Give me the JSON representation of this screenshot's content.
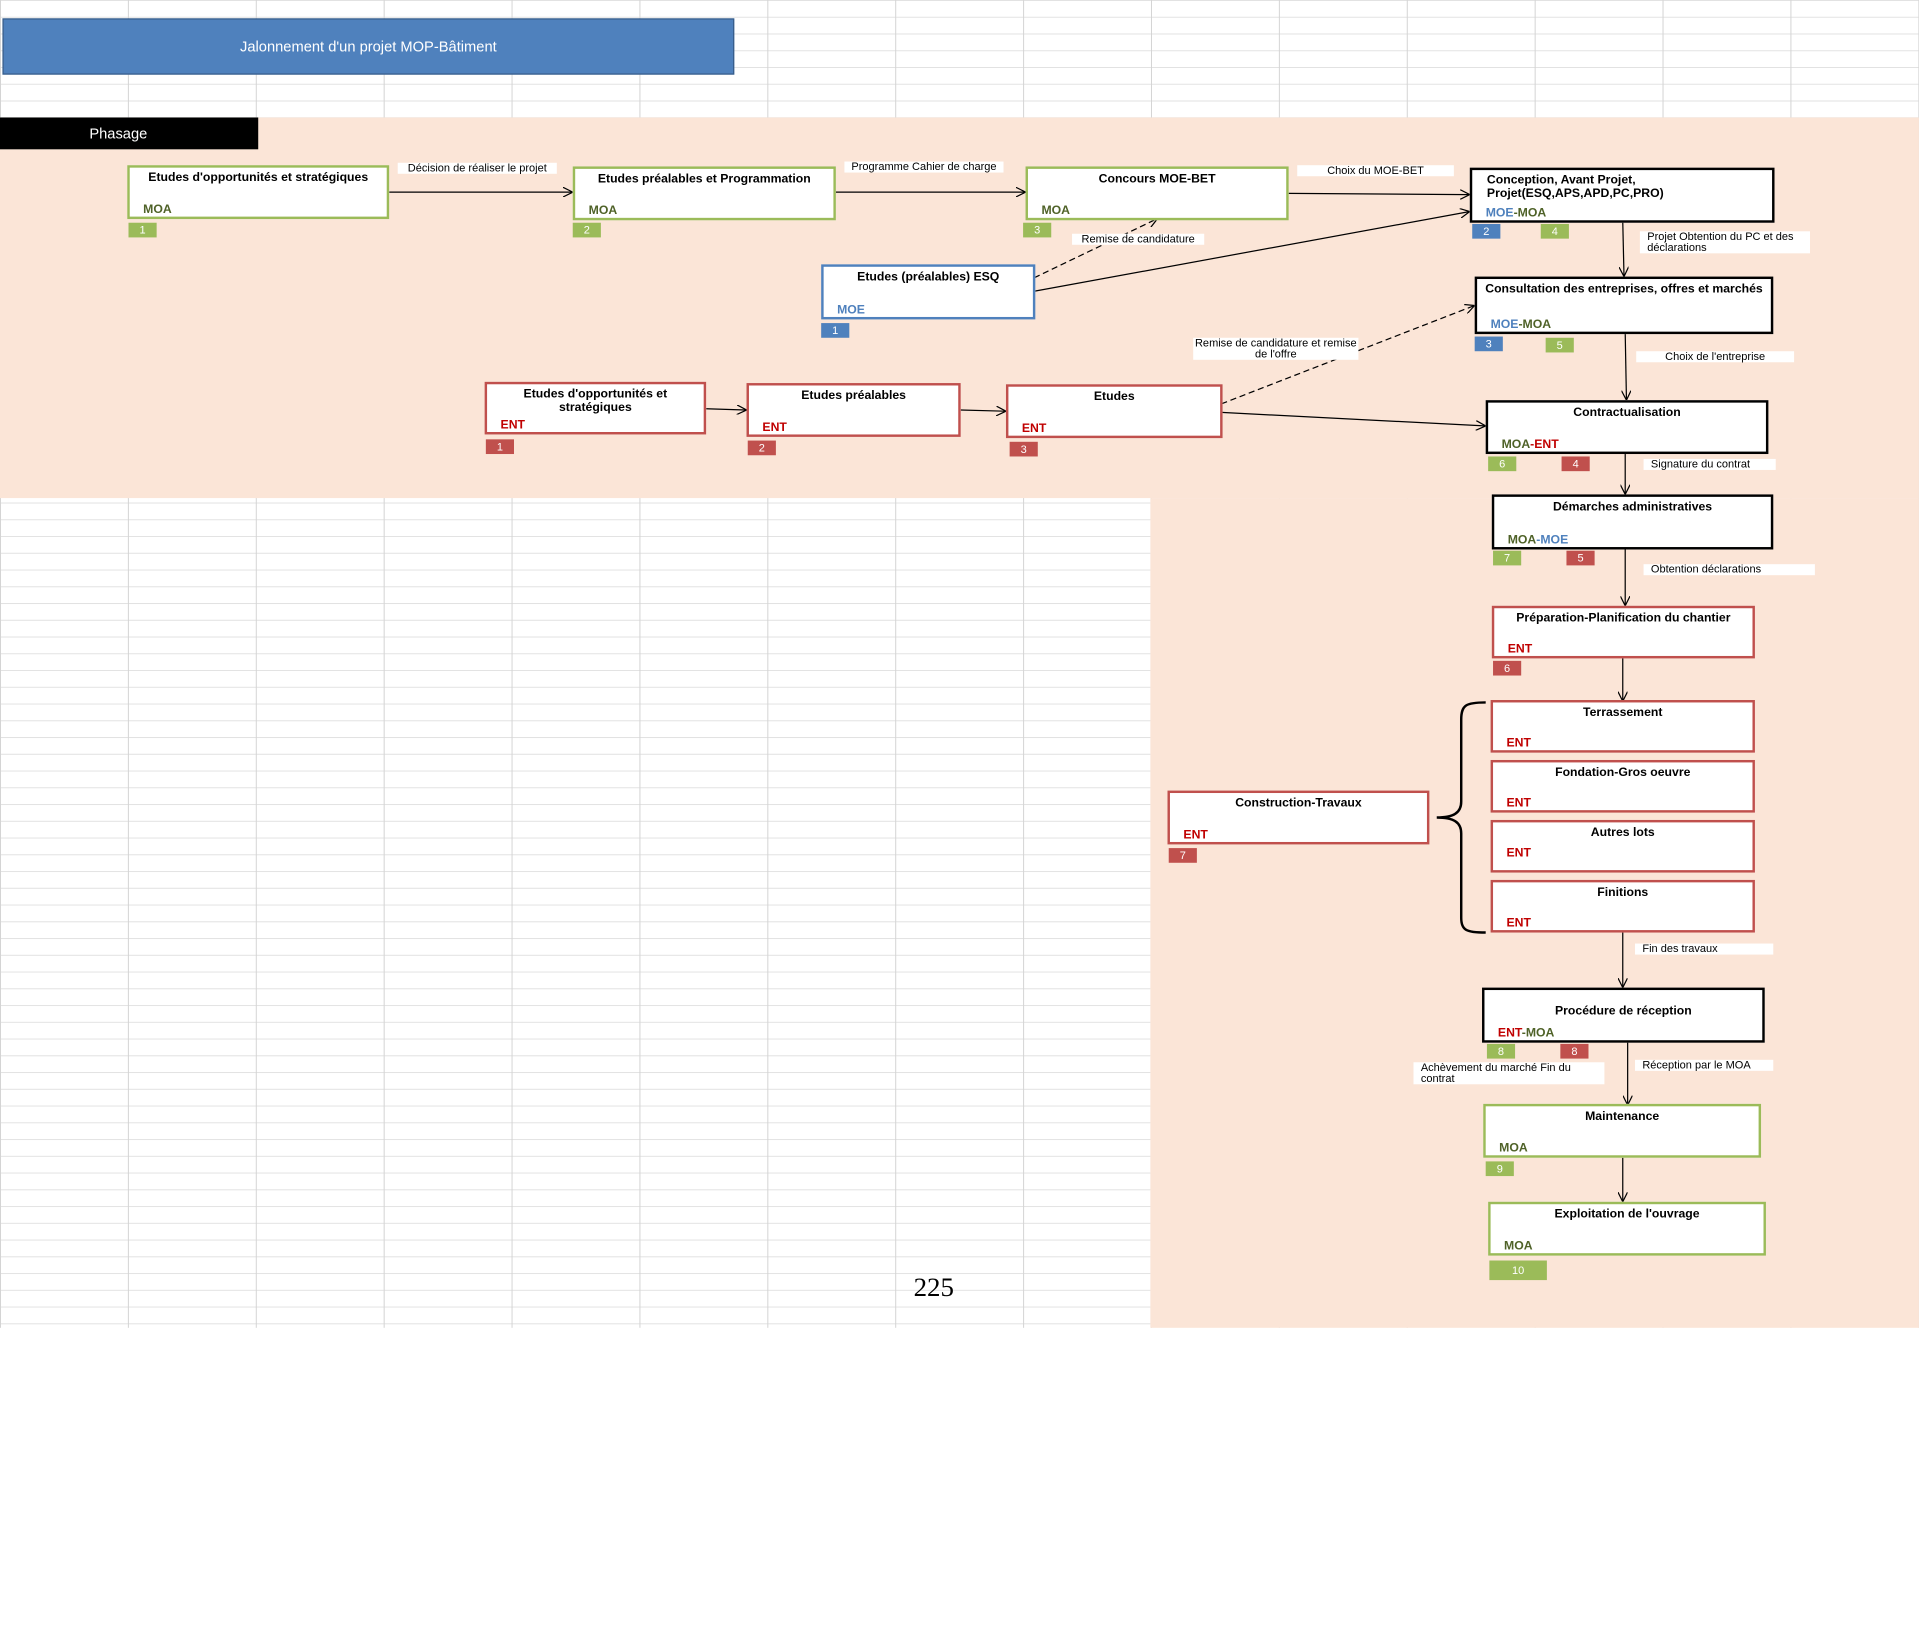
{
  "title": "Jalonnement d'un projet MOP-Bâtiment",
  "phase_label": "Phasage",
  "page_number": "225",
  "colors": {
    "moa": "#9bbb59",
    "moe": "#4f81bd",
    "ent": "#c0504d",
    "fill": "#fbe5d7"
  },
  "boxes": {
    "moa_etudes_opp": {
      "title": "Etudes d'opportunités  et stratégiques",
      "role": "MOA",
      "num": "1"
    },
    "moa_etudes_prea": {
      "title": "Etudes  préalables et Programmation",
      "role": "MOA",
      "num": "2"
    },
    "moa_concours": {
      "title": "Concours  MOE-BET",
      "role": "MOA",
      "num": "3"
    },
    "moe_esq": {
      "title": "Etudes  (préalables) ESQ",
      "role": "MOE",
      "num": "1"
    },
    "conception": {
      "title": "Conception,  Avant Projet, Projet(ESQ,APS,APD,PC,PRO)",
      "role_a": "MOE",
      "role_b": "-MOA",
      "num_a": "2",
      "num_b": "4"
    },
    "consultation": {
      "title": "Consultation  des entreprises, offres et marchés",
      "role_a": "MOE",
      "role_b": "-MOA",
      "num_a": "3",
      "num_b": "5"
    },
    "ent_etudes_opp": {
      "title": "Etudes d'opportunités et stratégiques",
      "role": "ENT",
      "num": "1"
    },
    "ent_etudes_prea": {
      "title": "Etudes  préalables",
      "role": "ENT",
      "num": "2"
    },
    "ent_etudes": {
      "title": "Etudes",
      "role": "ENT",
      "num": "3"
    },
    "contractualisation": {
      "title": "Contractualisation",
      "role_a": "MOA",
      "role_b": "-ENT",
      "num_a": "6",
      "num_b": "4"
    },
    "demarches": {
      "title": "Démarches administratives",
      "role_a": "MOA",
      "role_b": "-MOE",
      "num_a": "7",
      "num_b": "5"
    },
    "preparation": {
      "title": "Préparation-Planification  du chantier",
      "role": "ENT",
      "num": "6"
    },
    "terrassement": {
      "title": "Terrassement",
      "role": "ENT"
    },
    "fondation": {
      "title": "Fondation-Gros oeuvre",
      "role": "ENT"
    },
    "autres_lots": {
      "title": "Autres lots",
      "role": "ENT"
    },
    "finitions": {
      "title": "Finitions",
      "role": "ENT"
    },
    "construction": {
      "title": "Construction-Travaux",
      "role": "ENT",
      "num": "7"
    },
    "reception": {
      "title": "Procédure  de réception",
      "role_a": "ENT",
      "role_b": "-MOA",
      "num_a": "8",
      "num_b": "8"
    },
    "maintenance": {
      "title": "Maintenance",
      "role": "MOA",
      "num": "9"
    },
    "exploitation": {
      "title": "Exploitation  de l'ouvrage",
      "role": "MOA",
      "num": "10"
    }
  },
  "labels": {
    "decision": "Décision de réaliser le projet",
    "programme": "Programme Cahier de charge",
    "choix_moe": "Choix du MOE-BET",
    "remise_cand": "Remise de candidature",
    "projet_pc": "Projet Obtention du PC et des déclarations",
    "remise_offre": "Remise de candidature et remise de l'offre",
    "choix_ent": "Choix de l'entreprise",
    "signature": "Signature du contrat",
    "obtention": "Obtention déclarations",
    "fin_travaux": "Fin des travaux",
    "achevement": "Achèvement du marché Fin du contrat",
    "reception_moa": "Réception par le MOA"
  }
}
